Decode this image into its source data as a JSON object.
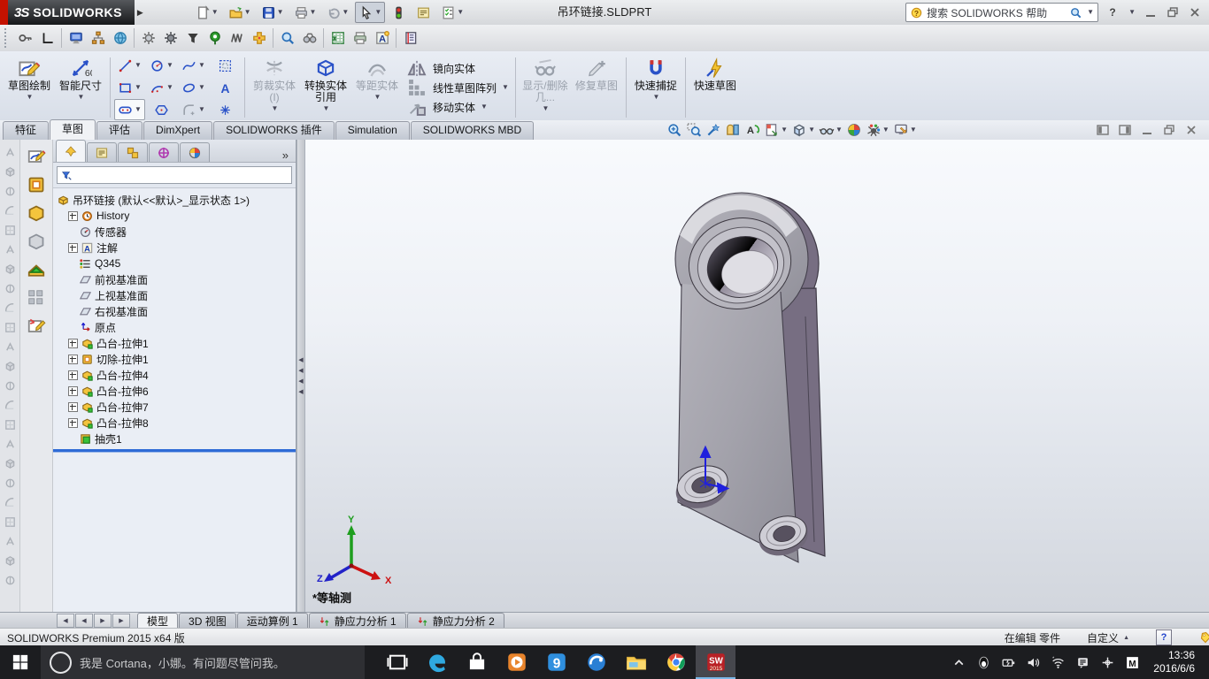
{
  "titlebar": {
    "logo_mark": "3S",
    "logo_word": "SOLIDWORKS",
    "title": "吊环链接.SLDPRT",
    "search_placeholder": "搜索 SOLIDWORKS 帮助",
    "quick_access": [
      {
        "name": "new-document-icon",
        "dropdown": true
      },
      {
        "name": "open-icon",
        "dropdown": true
      },
      {
        "name": "save-icon",
        "dropdown": true
      },
      {
        "name": "print-icon",
        "dropdown": true
      },
      {
        "name": "undo-icon",
        "dropdown": true
      },
      {
        "name": "select-icon",
        "dropdown": true,
        "pressed": true
      },
      {
        "name": "traffic-light-icon",
        "dropdown": false
      },
      {
        "name": "file-properties-icon",
        "dropdown": false
      },
      {
        "name": "options-icon",
        "dropdown": true
      }
    ],
    "window_buttons": [
      {
        "name": "help-icon"
      },
      {
        "name": "minimize-icon"
      },
      {
        "name": "restore-icon"
      },
      {
        "name": "close-icon"
      }
    ]
  },
  "toolbar2": {
    "items": [
      {
        "name": "key-icon"
      },
      {
        "name": "corner-ruler-icon"
      },
      {
        "sep": true
      },
      {
        "name": "monitor-icon"
      },
      {
        "name": "hierarchy-icon"
      },
      {
        "name": "globe-icon"
      },
      {
        "sep": true
      },
      {
        "name": "gear-icon"
      },
      {
        "name": "gear-dark-icon"
      },
      {
        "name": "funnel-icon"
      },
      {
        "name": "pin-icon"
      },
      {
        "name": "spring-icon"
      },
      {
        "name": "move-cross-icon"
      },
      {
        "sep": true
      },
      {
        "name": "magnifier-icon"
      },
      {
        "name": "binoculars-icon"
      },
      {
        "sep": true
      },
      {
        "name": "spreadsheet-icon"
      },
      {
        "name": "printer2-icon"
      },
      {
        "name": "text-style-icon"
      },
      {
        "sep": true
      },
      {
        "name": "notebook-icon"
      }
    ]
  },
  "ribbon": {
    "sketch": "草图绘制",
    "smart_dimension": "智能尺寸",
    "trim": "剪裁实体(I)",
    "convert": "转换实体引用",
    "offset": "等距实体",
    "mirror": "镜向实体",
    "linear_pattern": "线性草图阵列",
    "move": "移动实体",
    "display_delete": "显示/删除几...",
    "repair": "修复草图",
    "quick_snaps": "快速捕捉",
    "rapid_sketch": "快速草图",
    "entities": [
      {
        "name": "line-icon",
        "dropdown": true
      },
      {
        "name": "circle-icon",
        "dropdown": true
      },
      {
        "name": "spline-icon",
        "dropdown": true
      },
      {
        "name": "sketch-pattern-icon",
        "dropdown": false
      },
      {
        "name": "rectangle-icon",
        "dropdown": true
      },
      {
        "name": "arc-icon",
        "dropdown": true
      },
      {
        "name": "ellipse-icon",
        "dropdown": true
      },
      {
        "name": "sketch-text-icon",
        "dropdown": false
      },
      {
        "name": "slot-icon",
        "dropdown": true,
        "pressed": true
      },
      {
        "name": "polygon-icon",
        "dropdown": false
      },
      {
        "name": "fillet-icon",
        "dropdown": true,
        "disabled": true
      },
      {
        "name": "point-icon",
        "dropdown": false
      }
    ]
  },
  "command_tabs": {
    "items": [
      "特征",
      "草图",
      "评估",
      "DimXpert",
      "SOLIDWORKS 插件",
      "Simulation",
      "SOLIDWORKS MBD"
    ],
    "active_index": 1
  },
  "headsup": {
    "items": [
      {
        "name": "zoom-fit-icon"
      },
      {
        "name": "zoom-area-icon"
      },
      {
        "name": "previous-view-icon"
      },
      {
        "name": "section-view-icon"
      },
      {
        "name": "rotate-view-icon"
      },
      {
        "name": "apply-scene-icon",
        "arrow": true
      },
      {
        "name": "view-orientation-icon",
        "arrow": true
      },
      {
        "name": "display-style-icon",
        "arrow": true
      },
      {
        "name": "edit-appearance-icon"
      },
      {
        "name": "render-tools-icon",
        "arrow": true
      },
      {
        "name": "view-settings-icon",
        "arrow": true
      }
    ]
  },
  "pane_controls": [
    {
      "name": "pane-split-left-icon"
    },
    {
      "name": "pane-split-right-icon"
    },
    {
      "name": "pane-minimize-icon"
    },
    {
      "name": "pane-restore-icon"
    },
    {
      "name": "pane-close-icon"
    }
  ],
  "side_toolbars": {
    "a": [
      "arrow-tool-icon",
      "box-tool-icon",
      "cone-tool-icon",
      "wedge-tool-icon",
      "corner-tool-icon",
      "magnet-tool-icon",
      "wrench-tool-icon",
      "hook-tool-icon",
      "press-tool-icon",
      "flip-tool-icon",
      "grid-tool-icon",
      "angle-tool-icon",
      "shell-tool-icon",
      "rib-tool-icon",
      "draft-tool-icon",
      "dome-tool-icon",
      "wrap-tool-icon",
      "mirror-tool-icon",
      "scale-tool-icon",
      "hole-tool-icon",
      "thread-tool-icon",
      "stud-tool-icon",
      "cap-tool-icon"
    ],
    "b": [
      "sketch-color-icon",
      "cut-yellow-icon",
      "boss-yellow-icon",
      "box-gray-icon",
      "wedge-green-icon",
      "pattern-gray-icon",
      "sketch-edit-icon"
    ]
  },
  "feature_panel": {
    "tabs": [
      {
        "name": "featuremanager-tab",
        "active": true
      },
      {
        "name": "propertymanager-tab"
      },
      {
        "name": "configurationmanager-tab"
      },
      {
        "name": "dimxpertmanager-tab"
      },
      {
        "name": "displaymanager-tab"
      }
    ],
    "overflow": "»",
    "root": {
      "label": "吊环链接 (默认<<默认>_显示状态 1>)",
      "icon": "part-icon"
    },
    "items": [
      {
        "label": "History",
        "icon": "history-icon",
        "expandable": true
      },
      {
        "label": "传感器",
        "icon": "sensors-icon",
        "expandable": false
      },
      {
        "label": "注解",
        "icon": "annotations-icon",
        "expandable": true
      },
      {
        "label": "Q345",
        "icon": "material-icon",
        "expandable": false
      },
      {
        "label": "前视基准面",
        "icon": "plane-icon",
        "expandable": false
      },
      {
        "label": "上视基准面",
        "icon": "plane-icon",
        "expandable": false
      },
      {
        "label": "右视基准面",
        "icon": "plane-icon",
        "expandable": false
      },
      {
        "label": "原点",
        "icon": "origin-icon",
        "expandable": false
      },
      {
        "label": "凸台-拉伸1",
        "icon": "boss-extrude-icon",
        "expandable": true
      },
      {
        "label": "切除-拉伸1",
        "icon": "cut-extrude-icon",
        "expandable": true
      },
      {
        "label": "凸台-拉伸4",
        "icon": "boss-extrude-icon",
        "expandable": true
      },
      {
        "label": "凸台-拉伸6",
        "icon": "boss-extrude-icon",
        "expandable": true
      },
      {
        "label": "凸台-拉伸7",
        "icon": "boss-extrude-icon",
        "expandable": true
      },
      {
        "label": "凸台-拉伸8",
        "icon": "boss-extrude-icon",
        "expandable": true
      },
      {
        "label": "抽壳1",
        "icon": "shell-icon",
        "expandable": false
      }
    ]
  },
  "viewport": {
    "view_label": "*等轴测",
    "axis_labels": {
      "x": "X",
      "y": "Y",
      "z": "Z"
    },
    "axis_colors": {
      "x": "#cc1111",
      "y": "#1e9e1e",
      "z": "#2222c8"
    }
  },
  "bottom_tabs": {
    "nav": [
      {
        "name": "first-tab-button"
      },
      {
        "name": "previous-tab-button"
      },
      {
        "name": "next-tab-button"
      },
      {
        "name": "last-tab-button"
      }
    ],
    "items": [
      {
        "label": "模型",
        "active": true
      },
      {
        "label": "3D 视图"
      },
      {
        "label": "运动算例 1"
      },
      {
        "label": "静应力分析 1",
        "icon": "simulation-study-icon"
      },
      {
        "label": "静应力分析 2",
        "icon": "simulation-study-icon"
      }
    ]
  },
  "statusbar": {
    "left": "SOLIDWORKS Premium 2015 x64 版",
    "editing": "在编辑 零件",
    "custom": "自定义",
    "help": "?"
  },
  "taskbar": {
    "cortana": "我是 Cortana，小娜。有问题尽管问我。",
    "time": "13:36",
    "date": "2016/6/6",
    "apps": [
      {
        "name": "task-view-icon"
      },
      {
        "name": "edge-icon"
      },
      {
        "name": "store-icon"
      },
      {
        "name": "media-player-icon"
      },
      {
        "name": "qq-pinyin-icon"
      },
      {
        "name": "browser-icon"
      },
      {
        "name": "file-explorer-icon"
      },
      {
        "name": "chrome-icon"
      },
      {
        "name": "solidworks-icon",
        "active": true
      }
    ],
    "tray": [
      {
        "name": "tray-chevron-icon"
      },
      {
        "name": "qq-icon"
      },
      {
        "name": "battery-icon"
      },
      {
        "name": "volume-icon"
      },
      {
        "name": "wifi-icon"
      },
      {
        "name": "notes-icon"
      },
      {
        "name": "input-indicator-icon"
      },
      {
        "name": "ime-icon"
      }
    ]
  }
}
